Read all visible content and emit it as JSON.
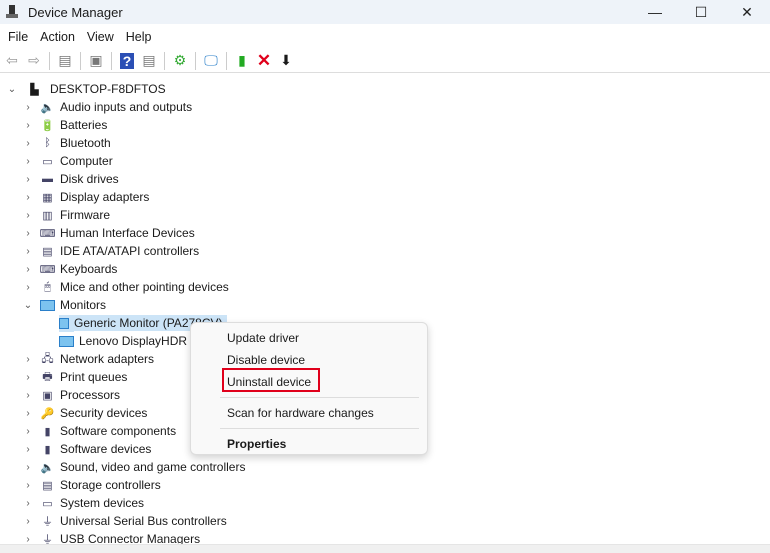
{
  "window": {
    "title": "Device Manager",
    "min": "—",
    "max": "☐",
    "close": "✕"
  },
  "menu": [
    "File",
    "Action",
    "View",
    "Help"
  ],
  "toolbar": [
    "back-icon",
    "forward-icon",
    "show-hide-console-tree-icon",
    "properties-icon",
    "help-icon",
    "action-pane-icon",
    "update-driver-icon",
    "scan-hardware-icon",
    "add-legacy-hardware-icon",
    "uninstall-icon",
    "disable-icon"
  ],
  "tree": {
    "root": "DESKTOP-F8DFTOS",
    "categories": [
      {
        "label": "Audio inputs and outputs",
        "icon": "🔈"
      },
      {
        "label": "Batteries",
        "icon": "🔋"
      },
      {
        "label": "Bluetooth",
        "icon": "ᛒ"
      },
      {
        "label": "Computer",
        "icon": "▭"
      },
      {
        "label": "Disk drives",
        "icon": "▬"
      },
      {
        "label": "Display adapters",
        "icon": "▦"
      },
      {
        "label": "Firmware",
        "icon": "▥"
      },
      {
        "label": "Human Interface Devices",
        "icon": "⌨"
      },
      {
        "label": "IDE ATA/ATAPI controllers",
        "icon": "▤"
      },
      {
        "label": "Keyboards",
        "icon": "⌨"
      },
      {
        "label": "Mice and other pointing devices",
        "icon": "🖱"
      },
      {
        "label": "Monitors",
        "icon": "mon",
        "expanded": true,
        "children": [
          "Generic Monitor (PA278CV)",
          "Lenovo DisplayHDR"
        ]
      },
      {
        "label": "Network adapters",
        "icon": "🖧"
      },
      {
        "label": "Print queues",
        "icon": "🖶"
      },
      {
        "label": "Processors",
        "icon": "▣"
      },
      {
        "label": "Security devices",
        "icon": "🔑"
      },
      {
        "label": "Software components",
        "icon": "▮"
      },
      {
        "label": "Software devices",
        "icon": "▮"
      },
      {
        "label": "Sound, video and game controllers",
        "icon": "🔈"
      },
      {
        "label": "Storage controllers",
        "icon": "▤"
      },
      {
        "label": "System devices",
        "icon": "▭"
      },
      {
        "label": "Universal Serial Bus controllers",
        "icon": "⏚"
      },
      {
        "label": "USB Connector Managers",
        "icon": "⏚"
      }
    ]
  },
  "context_menu": {
    "update": "Update driver",
    "disable": "Disable device",
    "uninstall": "Uninstall device",
    "scan": "Scan for hardware changes",
    "properties": "Properties"
  },
  "highlight_color": "#e0001b"
}
